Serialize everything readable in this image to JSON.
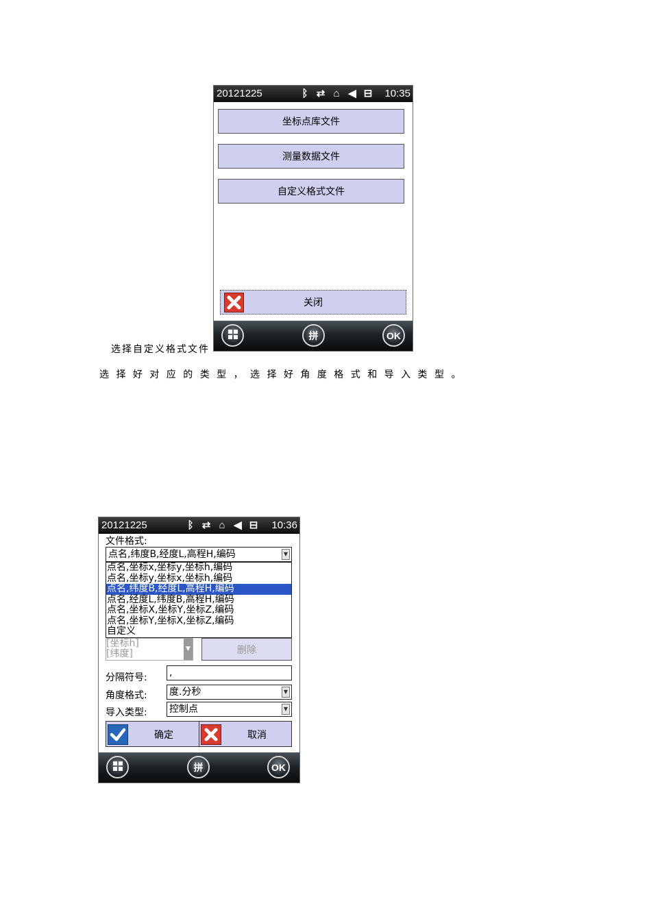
{
  "caption_select": "选择自定义格式文件",
  "instruction": "选 择 好 对 应 的 类 型 ， 选 择 好 角 度 格 式 和 导 入 类 型 。",
  "screen1": {
    "date": "20121225",
    "time": "10:35",
    "buttons": [
      "坐标点库文件",
      "测量数据文件",
      "自定义格式文件"
    ],
    "close_label": "关闭",
    "softkey_center": "拼",
    "softkey_right": "OK"
  },
  "screen2": {
    "date": "20121225",
    "time": "10:36",
    "file_format_label": "文件格式:",
    "file_format_value": "点名,纬度B,经度L,高程H,编码",
    "options": [
      "点名,坐标x,坐标y,坐标h,编码",
      "点名,坐标y,坐标x,坐标h,编码",
      "点名,纬度B,经度L,高程H,编码",
      "点名,经度L,纬度B,高程H,编码",
      "点名,坐标X,坐标Y,坐标Z,编码",
      "点名,坐标Y,坐标X,坐标Z,编码",
      "自定义"
    ],
    "selected_option_index": 2,
    "hidden_items": [
      "[坐标h]",
      "[纬度]"
    ],
    "delete_label": "删除",
    "separator_label": "分隔符号:",
    "separator_value": ",",
    "angle_format_label": "角度格式:",
    "angle_format_value": "度.分秒",
    "import_type_label": "导入类型:",
    "import_type_value": "控制点",
    "confirm_label": "确定",
    "cancel_label": "取消",
    "softkey_center": "拼",
    "softkey_right": "OK"
  }
}
